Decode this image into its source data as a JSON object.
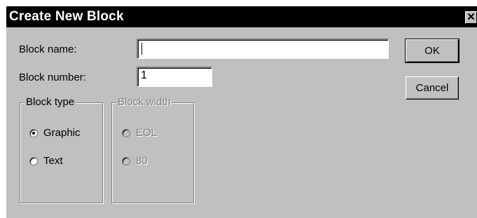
{
  "window": {
    "title": "Create New Block",
    "close_glyph": "✕"
  },
  "form": {
    "block_name_label": "Block name:",
    "block_name_value": "",
    "block_number_label": "Block number:",
    "block_number_value": "1"
  },
  "buttons": {
    "ok_label": "OK",
    "cancel_label": "Cancel"
  },
  "block_type": {
    "legend": "Block type",
    "options": [
      {
        "label": "Graphic",
        "selected": true
      },
      {
        "label": "Text",
        "selected": false
      }
    ]
  },
  "block_width": {
    "legend": "Block width",
    "enabled": false,
    "options": [
      {
        "label": "EOL",
        "selected": false
      },
      {
        "label": "80",
        "selected": false
      }
    ]
  },
  "colors": {
    "dialog_face": "#c0c0c0",
    "titlebar": "#000000",
    "disabled_text": "#808080"
  }
}
